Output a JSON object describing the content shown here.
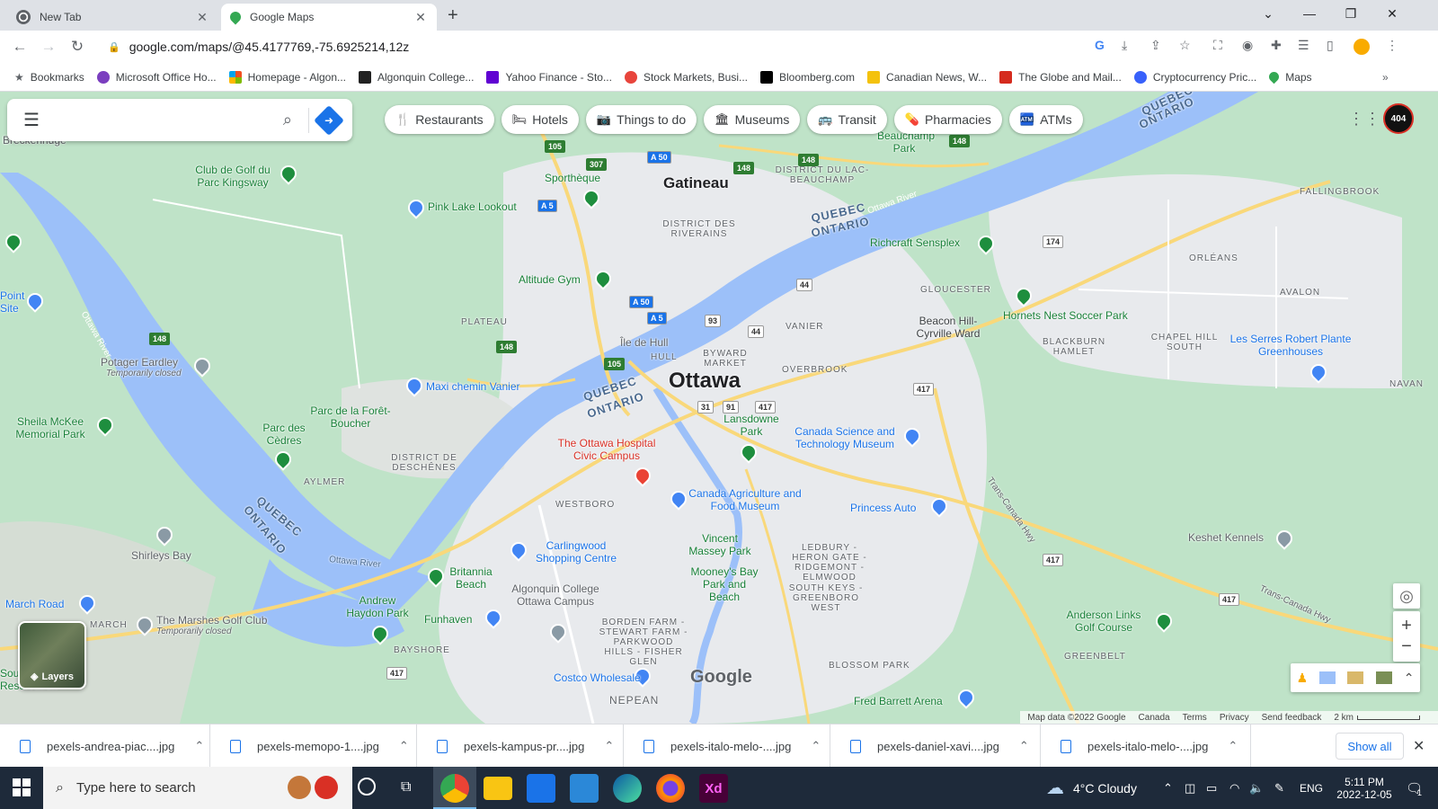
{
  "browser": {
    "tabs": [
      {
        "title": "New Tab"
      },
      {
        "title": "Google Maps"
      }
    ],
    "url": "google.com/maps/@45.4177769,-75.6925214,12z",
    "bookmarks": [
      {
        "label": "Bookmarks",
        "color": "#5f6368"
      },
      {
        "label": "Microsoft Office Ho...",
        "color": "#7b3fbf"
      },
      {
        "label": "Homepage - Algon...",
        "color": "#f25022"
      },
      {
        "label": "Algonquin College...",
        "color": "#222222"
      },
      {
        "label": "Yahoo Finance - Sto...",
        "color": "#6001d2"
      },
      {
        "label": "Stock Markets, Busi...",
        "color": "#e8453c"
      },
      {
        "label": "Bloomberg.com",
        "color": "#000000"
      },
      {
        "label": "Canadian News, W...",
        "color": "#f4c20d"
      },
      {
        "label": "The Globe and Mail...",
        "color": "#d52b1e"
      },
      {
        "label": "Cryptocurrency Pric...",
        "color": "#3861fb"
      },
      {
        "label": "Maps",
        "color": "#34a853"
      }
    ]
  },
  "map": {
    "chips": [
      {
        "icon": "fork-knife-icon",
        "glyph": "🍴",
        "label": "Restaurants"
      },
      {
        "icon": "bed-icon",
        "glyph": "🛏",
        "label": "Hotels"
      },
      {
        "icon": "camera-icon",
        "glyph": "📷",
        "label": "Things to do"
      },
      {
        "icon": "museum-icon",
        "glyph": "🏛",
        "label": "Museums"
      },
      {
        "icon": "bus-icon",
        "glyph": "🚌",
        "label": "Transit"
      },
      {
        "icon": "pharmacy-icon",
        "glyph": "💊",
        "label": "Pharmacies"
      },
      {
        "icon": "atm-icon",
        "glyph": "🏧",
        "label": "ATMs"
      }
    ],
    "labels": {
      "ottawa": "Ottawa",
      "gatineau": "Gatineau",
      "vanier": "VANIER",
      "orleans": "ORLÉANS",
      "aylmer": "AYLMER",
      "plateau": "PLATEAU",
      "westboro": "WESTBORO",
      "gloucester": "GLOUCESTER",
      "avalon": "AVALON",
      "fallingbrook": "FALLINGBROOK",
      "blackburn": "BLACKBURN HAMLET",
      "chapel_hill": "CHAPEL HILL SOUTH",
      "greenbelt": "GREENBELT",
      "blossom": "BLOSSOM PARK",
      "nepean": "NEPEAN",
      "bayshore": "BAYSHORE",
      "march": "MARCH",
      "deschenes": "DISTRICT DE DESCHÊNES",
      "riverains": "DISTRICT DES RIVERAINS",
      "lac_beauchamp": "DISTRICT DU LAC-BEAUCHAMP",
      "ledbury": "LEDBURY - HERON GATE - RIDGEMONT - ELMWOOD",
      "south_keys": "SOUTH KEYS - GREENBORO WEST",
      "borden": "BORDEN FARM - STEWART FARM - PARKWOOD HILLS - FISHER GLEN",
      "overbrook": "OVERBROOK",
      "byward": "BYWARD MARKET",
      "hull": "HULL",
      "navan": "NAVAN",
      "ile_de_hull": "Île de Hull",
      "beacon_hill": "Beacon Hill-Cyrville Ward",
      "breckenridge": "Breckenridge",
      "quebec1": "QUEBEC",
      "ontario1": "ONTARIO",
      "quebec2": "QUEBEC",
      "ontario2": "ONTARIO",
      "quebec3": "QUEBEC",
      "ontario3": "ONTARIO",
      "quebec4": "QUEBEC",
      "ontario4": "ONTARIO",
      "ottawa_river1": "Ottawa River",
      "ottawa_river2": "Ottawa River",
      "ottawa_river3": "Ottawa River",
      "trans_canada1": "Trans-Canada Hwy",
      "trans_canada2": "Trans-Canada Hwy"
    },
    "pois": {
      "club_golf": "Club de Golf du Parc Kingsway",
      "sportheque": "Sporthèque",
      "pink_lake": "Pink Lake Lookout",
      "altitude": "Altitude Gym",
      "richcraft": "Richcraft Sensplex",
      "hornets": "Hornets Nest Soccer Park",
      "serres": "Les Serres Robert Plante Greenhouses",
      "potager": "Potager Eardley",
      "temp_closed1": "Temporarily closed",
      "maxi": "Maxi chemin Vanier",
      "sheila": "Sheila McKee Memorial Park",
      "parc_cedres": "Parc des Cèdres",
      "foret_boucher": "Parc de la Forêt-Boucher",
      "hospital": "The Ottawa Hospital Civic Campus",
      "lansdowne": "Lansdowne Park",
      "science": "Canada Science and Technology Museum",
      "agriculture": "Canada Agriculture and Food Museum",
      "princess": "Princess Auto",
      "carlingwood": "Carlingwood Shopping Centre",
      "britannia": "Britannia Beach",
      "shirleys": "Shirleys Bay",
      "andrew_haydon": "Andrew Haydon Park",
      "funhaven": "Funhaven",
      "algonquin": "Algonquin College Ottawa Campus",
      "vincent_massey": "Vincent Massey Park",
      "mooneys": "Mooney's Bay Park and Beach",
      "keshet": "Keshet Kennels",
      "anderson": "Anderson Links Golf Course",
      "marshes": "The Marshes Golf Club",
      "temp_closed2": "Temporarily closed",
      "costco": "Costco Wholesale",
      "fred_barrett": "Fred Barrett Arena",
      "beauchamp": "Beauchamp Park",
      "march_road": "March Road",
      "point_site": "Point Site",
      "south_reservation": "South Reservation"
    },
    "logo": "Google",
    "layers_label": "Layers",
    "footer": {
      "mapdata": "Map data ©2022 Google",
      "canada": "Canada",
      "terms": "Terms",
      "privacy": "Privacy",
      "feedback": "Send feedback",
      "scale": "2 km"
    },
    "avatar_text": "404"
  },
  "downloads": {
    "items": [
      "pexels-andrea-piac....jpg",
      "pexels-memopo-1....jpg",
      "pexels-kampus-pr....jpg",
      "pexels-italo-melo-....jpg",
      "pexels-daniel-xavi....jpg",
      "pexels-italo-melo-....jpg"
    ],
    "show_all": "Show all"
  },
  "taskbar": {
    "search_placeholder": "Type here to search",
    "weather": "4°C  Cloudy",
    "lang": "ENG",
    "time": "5:11 PM",
    "date": "2022-12-05",
    "notif_count": "1"
  }
}
